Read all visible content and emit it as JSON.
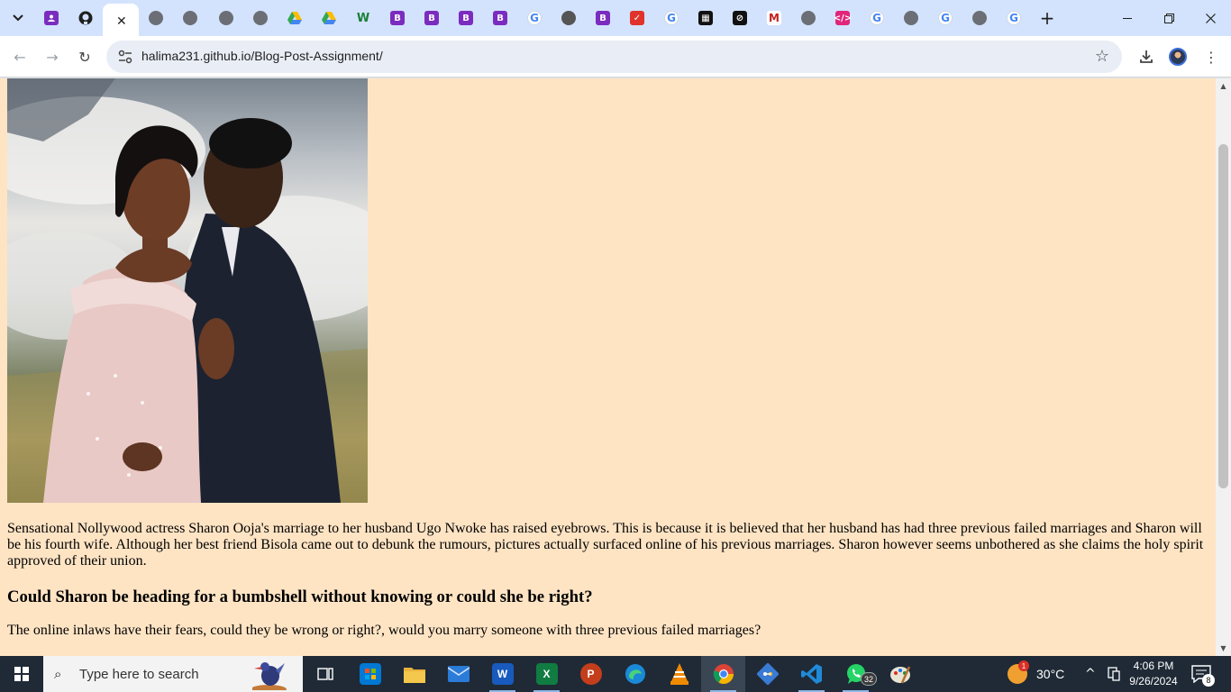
{
  "browser": {
    "tabs": [
      {
        "icon": "search-tabs-icon"
      },
      {
        "icon": "contacts-icon"
      },
      {
        "icon": "github-icon"
      },
      {
        "icon": "globe-icon",
        "active": true
      },
      {
        "icon": "globe-icon"
      },
      {
        "icon": "globe-icon"
      },
      {
        "icon": "globe-icon"
      },
      {
        "icon": "globe-icon"
      },
      {
        "icon": "google-drive-icon"
      },
      {
        "icon": "google-drive-icon"
      },
      {
        "icon": "w-icon"
      },
      {
        "icon": "bootstrap-icon",
        "letter": "B"
      },
      {
        "icon": "bootstrap-icon",
        "letter": "B"
      },
      {
        "icon": "bootstrap-icon",
        "letter": "B"
      },
      {
        "icon": "bootstrap-icon",
        "letter": "B"
      },
      {
        "icon": "google-icon",
        "letter": "G"
      },
      {
        "icon": "chrome-icon"
      },
      {
        "icon": "bootstrap-icon",
        "letter": "B"
      },
      {
        "icon": "red-app-icon"
      },
      {
        "icon": "google-icon",
        "letter": "G"
      },
      {
        "icon": "film-icon"
      },
      {
        "icon": "dark-app-icon"
      },
      {
        "icon": "gmail-icon",
        "letter": "M"
      },
      {
        "icon": "globe-icon"
      },
      {
        "icon": "code-icon"
      },
      {
        "icon": "google-icon",
        "letter": "G"
      },
      {
        "icon": "globe-icon"
      },
      {
        "icon": "google-icon",
        "letter": "G"
      },
      {
        "icon": "globe-icon"
      },
      {
        "icon": "google-icon",
        "letter": "G"
      }
    ],
    "url": "halima231.github.io/Blog-Post-Assignment/"
  },
  "page": {
    "paragraph1": "Sensational Nollywood actress Sharon Ooja's marriage to her husband Ugo Nwoke has raised eyebrows. This is because it is believed that her husband has had three previous failed marriages and Sharon will be his fourth wife. Although her best friend Bisola came out to debunk the rumours, pictures actually surfaced online of his previous marriages. Sharon however seems unbothered as she claims the holy spirit approved of their union.",
    "heading": "Could Sharon be heading for a bumbshell without knowing or could she be right?",
    "paragraph2": "The online inlaws have their fears, could they be wrong or right?, would you marry someone with three previous failed marriages?",
    "background_color": "#ffe4c4"
  },
  "taskbar": {
    "search_placeholder": "Type here to search",
    "apps": [
      {
        "name": "task-view",
        "icon": "task-view-icon"
      },
      {
        "name": "microsoft-store",
        "icon": "store-icon"
      },
      {
        "name": "file-explorer",
        "icon": "folder-icon"
      },
      {
        "name": "mail",
        "icon": "mail-icon"
      },
      {
        "name": "word",
        "icon": "word-icon",
        "letter": "W"
      },
      {
        "name": "excel",
        "icon": "excel-icon",
        "letter": "X"
      },
      {
        "name": "powerpoint",
        "icon": "powerpoint-icon",
        "letter": "P"
      },
      {
        "name": "edge",
        "icon": "edge-icon"
      },
      {
        "name": "vlc",
        "icon": "vlc-icon"
      },
      {
        "name": "chrome",
        "icon": "chrome-icon"
      },
      {
        "name": "git",
        "icon": "git-icon"
      },
      {
        "name": "vscode",
        "icon": "vscode-icon"
      },
      {
        "name": "whatsapp",
        "icon": "whatsapp-icon"
      },
      {
        "name": "paint",
        "icon": "paint-icon"
      }
    ],
    "whatsapp_badge": "32",
    "weather_badge": "1",
    "temperature": "30°C",
    "time": "4:06 PM",
    "date": "9/26/2024",
    "notification_count": "8"
  }
}
